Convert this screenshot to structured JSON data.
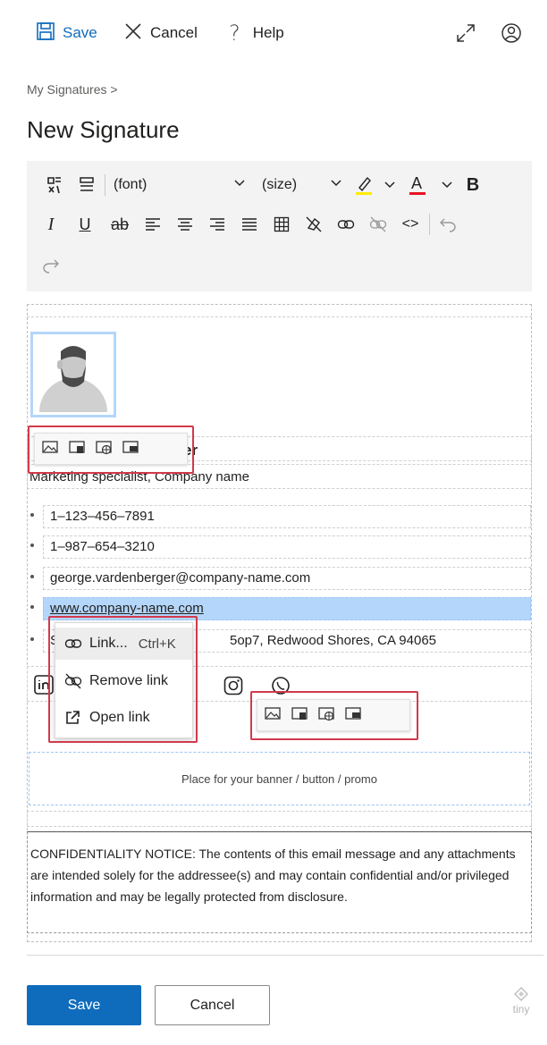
{
  "topbar": {
    "save_label": "Save",
    "cancel_label": "Cancel",
    "help_label": "Help"
  },
  "breadcrumb": "My Signatures >",
  "page_title": "New Signature",
  "toolbar": {
    "font_select": "(font)",
    "size_select": "(size)",
    "highlight_color": "#ffeb00",
    "text_color": "#e81123"
  },
  "signature": {
    "name_fragment": "er",
    "job_title": "Marketing specialist, Company name",
    "details": [
      "1–123–456–7891",
      "1–987–654–3210",
      "george.vardenberger@company-name.com",
      "www.company-name.com",
      "5op7, Redwood Shores, CA 94065"
    ],
    "address_prefix": "S",
    "banner_text": "Place for your banner / button / promo",
    "notice": "CONFIDENTIALITY NOTICE: The contents of this email message and any attachments are intended solely for the addressee(s) and may contain confidential and/or privileged information and may be legally protected from disclosure."
  },
  "context_menu": {
    "items": [
      {
        "label": "Link...",
        "shortcut": "Ctrl+K"
      },
      {
        "label": "Remove link",
        "shortcut": ""
      },
      {
        "label": "Open link",
        "shortcut": ""
      }
    ]
  },
  "footer": {
    "save_label": "Save",
    "cancel_label": "Cancel",
    "brand": "tiny"
  },
  "colors": {
    "accent": "#0f6cbd",
    "selection": "#b4d6fa",
    "highlight_red": "#d13a4c"
  }
}
